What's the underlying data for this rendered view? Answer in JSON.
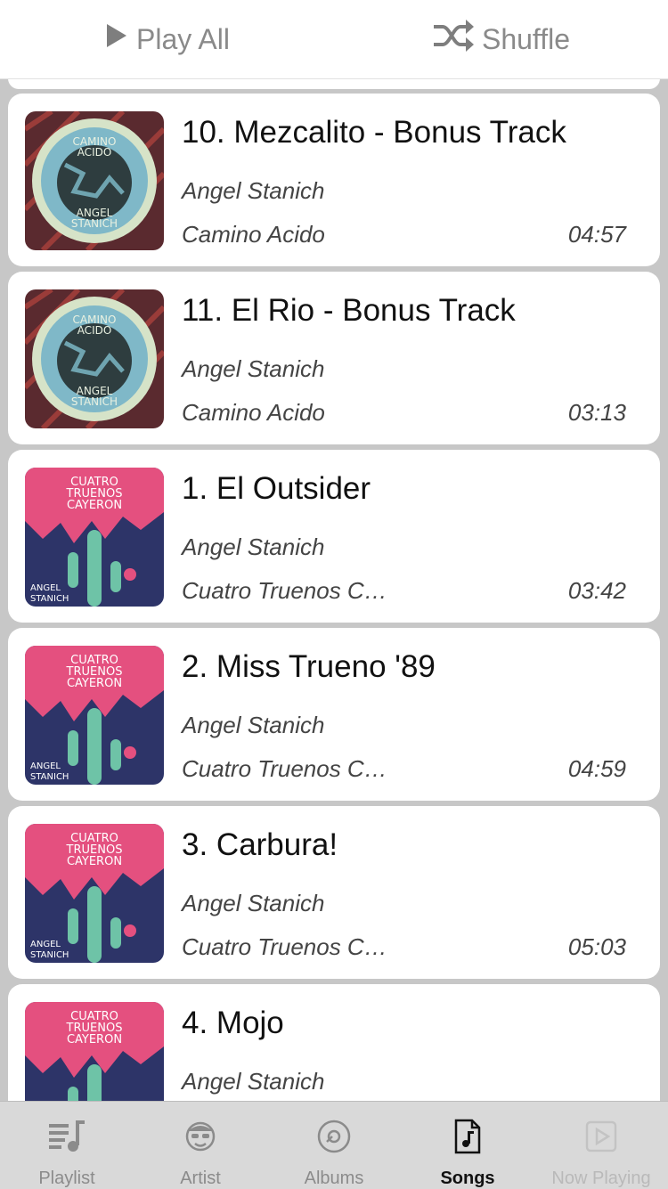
{
  "header": {
    "play_all_label": "Play All",
    "shuffle_label": "Shuffle",
    "play_icon": "play-icon",
    "shuffle_icon": "shuffle-icon"
  },
  "songs": [
    {
      "title": "10. Mezcalito - Bonus Track",
      "artist": "Angel Stanich",
      "album": "Camino Acido",
      "duration": "04:57",
      "art": "camino-acido-cover"
    },
    {
      "title": "11. El Rio - Bonus Track",
      "artist": "Angel Stanich",
      "album": "Camino Acido",
      "duration": "03:13",
      "art": "camino-acido-cover"
    },
    {
      "title": "1. El Outsider",
      "artist": "Angel Stanich",
      "album": "Cuatro Truenos Ca…",
      "duration": "03:42",
      "art": "cuatro-truenos-cover"
    },
    {
      "title": "2. Miss Trueno '89",
      "artist": "Angel Stanich",
      "album": "Cuatro Truenos Ca…",
      "duration": "04:59",
      "art": "cuatro-truenos-cover"
    },
    {
      "title": "3. Carbura!",
      "artist": "Angel Stanich",
      "album": "Cuatro Truenos Ca…",
      "duration": "05:03",
      "art": "cuatro-truenos-cover"
    },
    {
      "title": "4. Mojo",
      "artist": "Angel Stanich",
      "album": "",
      "duration": "",
      "art": "cuatro-truenos-cover"
    }
  ],
  "tabs": [
    {
      "label": "Playlist",
      "icon": "playlist-icon",
      "state": "normal"
    },
    {
      "label": "Artist",
      "icon": "artist-icon",
      "state": "normal"
    },
    {
      "label": "Albums",
      "icon": "albums-icon",
      "state": "normal"
    },
    {
      "label": "Songs",
      "icon": "songs-icon",
      "state": "active"
    },
    {
      "label": "Now Playing",
      "icon": "now-playing-icon",
      "state": "disabled"
    }
  ],
  "colors": {
    "background": "#c7c7c7",
    "card": "#ffffff",
    "tabbar": "#d9d9d9",
    "active_tab": "#111111",
    "inactive_tab": "#8b8b8b"
  }
}
